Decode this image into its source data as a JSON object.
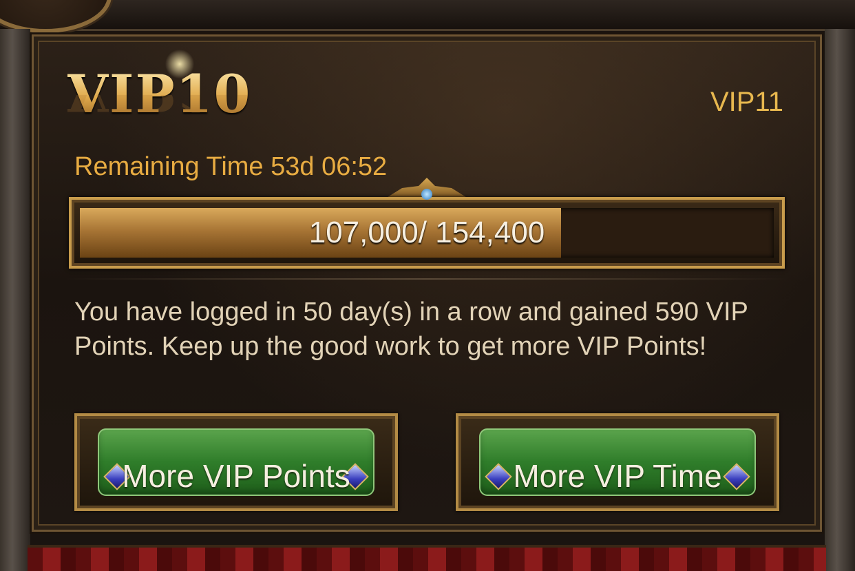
{
  "vip": {
    "current_level": "VIP10",
    "next_level": "VIP11",
    "remaining_time": "Remaining Time 53d 06:52"
  },
  "progress": {
    "current": 107000,
    "target": 154400,
    "text": "107,000/ 154,400"
  },
  "message": "You have logged in 50 day(s) in a row and gained 590 VIP Points.  Keep up the good work to get more VIP Points!",
  "buttons": {
    "more_points": "More VIP Points",
    "more_time": "More VIP Time"
  },
  "colors": {
    "gold": "#e8ac42",
    "button_green": "#2f7d2a",
    "text_light": "#e2d3b7"
  }
}
